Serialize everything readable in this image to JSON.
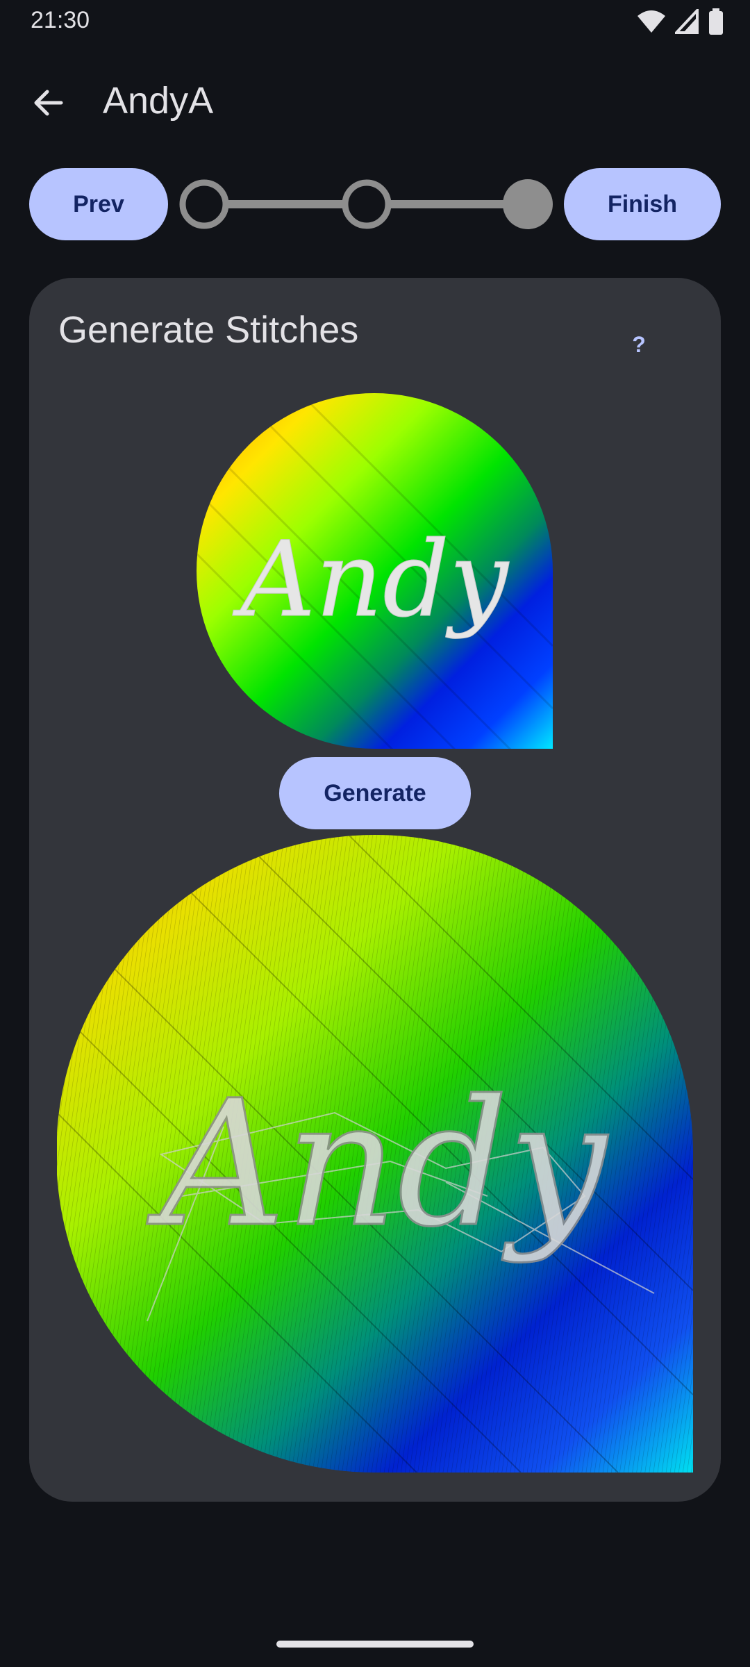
{
  "status_bar": {
    "time": "21:30",
    "icons": [
      "wifi-icon",
      "signal-icon",
      "battery-icon"
    ]
  },
  "app_bar": {
    "title": "AndyA",
    "back_icon": "arrow-left-icon"
  },
  "wizard": {
    "prev_label": "Prev",
    "finish_label": "Finish",
    "steps_total": 3,
    "current_step": 3
  },
  "card": {
    "title": "Generate Stitches",
    "help_label": "?",
    "preview_text": "Andy",
    "generate_label": "Generate",
    "stitch_preview_text": "Andy"
  },
  "colors": {
    "background": "#111318",
    "card": "#33353b",
    "accent": "#b7c4ff",
    "on_accent": "#132463",
    "text": "#e3e2e6",
    "step_inactive": "#8e8e8e"
  }
}
